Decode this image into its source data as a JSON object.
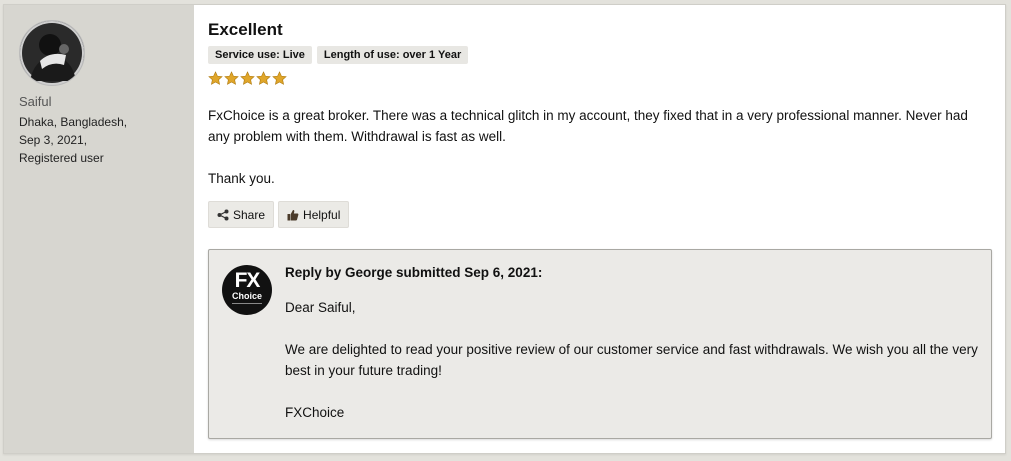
{
  "reviewer": {
    "name": "Saiful",
    "location": "Dhaka, Bangladesh,",
    "date": "Sep 3, 2021,",
    "status": "Registered user"
  },
  "review": {
    "title": "Excellent",
    "tags": [
      "Service use: Live",
      "Length of use: over 1 Year"
    ],
    "rating": 5,
    "star_color": "#e0a62a",
    "paragraphs": [
      "FxChoice is a great broker. There was a technical glitch in my account, they fixed that in a very professional manner. Never had any problem with them. Withdrawal is fast as well.",
      "Thank you."
    ]
  },
  "actions": {
    "share_label": "Share",
    "share_icon": "share-icon",
    "helpful_label": "Helpful",
    "helpful_icon": "thumbs-up-icon"
  },
  "reply": {
    "heading": "Reply by George submitted Sep 6, 2021:",
    "logo_line1": "FX",
    "logo_line2": "Choice",
    "paragraphs": [
      "Dear Saiful,",
      "We are delighted to read your positive review of our customer service and fast withdrawals. We wish you all the very best in your future trading!",
      "FXChoice"
    ]
  }
}
